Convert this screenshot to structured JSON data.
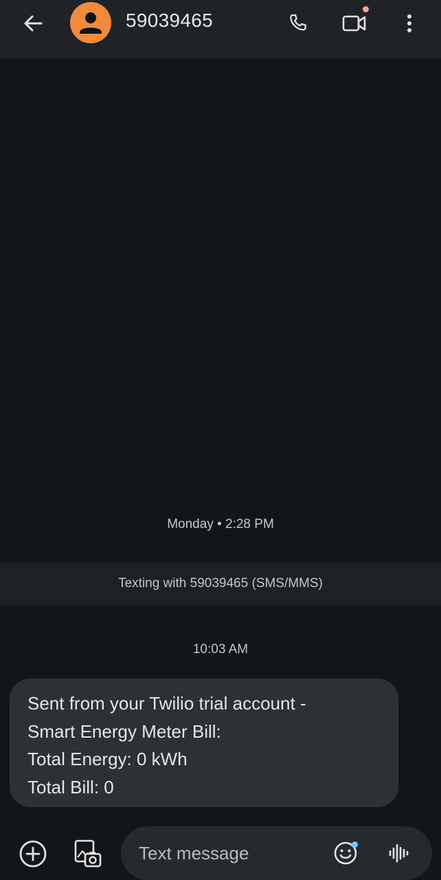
{
  "header": {
    "contact_name": "59039465",
    "avatar_color": "#f08a3c",
    "icons": {
      "back": "arrow-back-icon",
      "call": "phone-icon",
      "video": "video-call-icon",
      "more": "more-vert-icon"
    }
  },
  "conversation": {
    "date_label": "Monday • 2:28 PM",
    "info_band": "Texting with 59039465 (SMS/MMS)",
    "time_label": "10:03 AM",
    "message": {
      "lines": [
        "Sent from your Twilio trial account -",
        "Smart Energy Meter Bill:",
        "Total Energy: 0 kWh",
        "Total Bill: 0"
      ]
    }
  },
  "compose": {
    "placeholder": "Text message",
    "value": "",
    "icons": {
      "add": "add-circle-icon",
      "gallery": "gallery-camera-icon",
      "emoji": "emoji-icon",
      "voice": "voice-waveform-icon"
    }
  },
  "colors": {
    "background": "#131619",
    "topbar": "#1f2328",
    "bubble": "#2d3135",
    "compose": "#262a2e",
    "notification_dot": "#f4a49a",
    "emoji_dot": "#7cc4ff"
  }
}
